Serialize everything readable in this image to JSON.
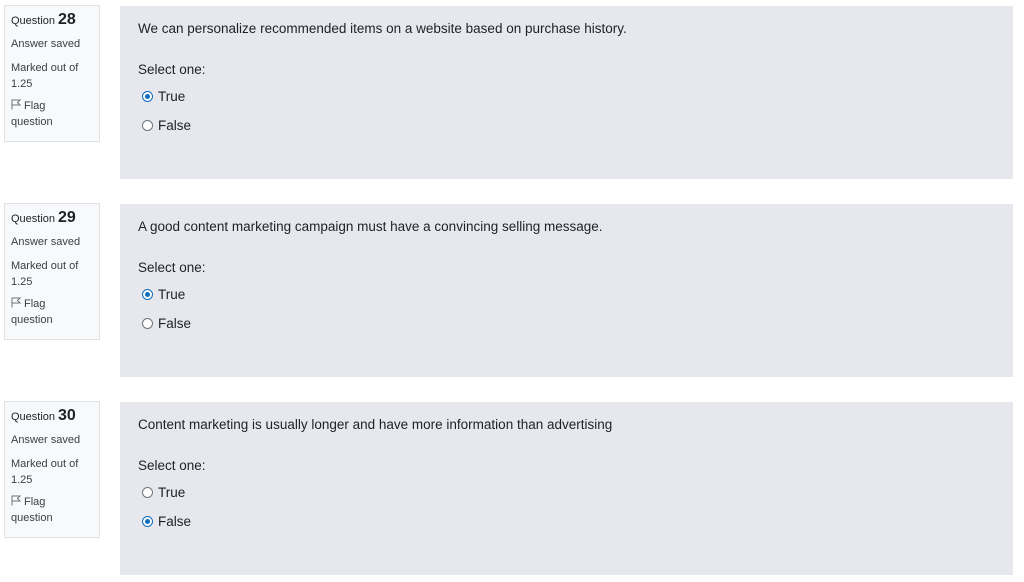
{
  "questions": [
    {
      "label": "Question",
      "number": "28",
      "state": "Answer saved",
      "grade_line1": "Marked out of",
      "grade_line2": "1.25",
      "flag_line1": "Flag",
      "flag_line2": "question",
      "text": "We can personalize recommended items on a website based on purchase history.",
      "prompt": "Select one:",
      "options": [
        {
          "label": "True",
          "checked": true
        },
        {
          "label": "False",
          "checked": false
        }
      ]
    },
    {
      "label": "Question",
      "number": "29",
      "state": "Answer saved",
      "grade_line1": "Marked out of",
      "grade_line2": "1.25",
      "flag_line1": "Flag",
      "flag_line2": "question",
      "text": "A good content marketing campaign must have a convincing selling message.",
      "prompt": "Select one:",
      "options": [
        {
          "label": "True",
          "checked": true
        },
        {
          "label": "False",
          "checked": false
        }
      ]
    },
    {
      "label": "Question",
      "number": "30",
      "state": "Answer saved",
      "grade_line1": "Marked out of",
      "grade_line2": "1.25",
      "flag_line1": "Flag",
      "flag_line2": "question",
      "text": "Content marketing is usually longer and have more information than advertising",
      "prompt": "Select one:",
      "options": [
        {
          "label": "True",
          "checked": false
        },
        {
          "label": "False",
          "checked": true
        }
      ]
    }
  ],
  "colors": {
    "radio_accent": "#0f6cbf",
    "content_bg": "#e7e8ee",
    "info_bg": "#f8f9fa"
  },
  "icons": {
    "flag": "flag-icon"
  }
}
